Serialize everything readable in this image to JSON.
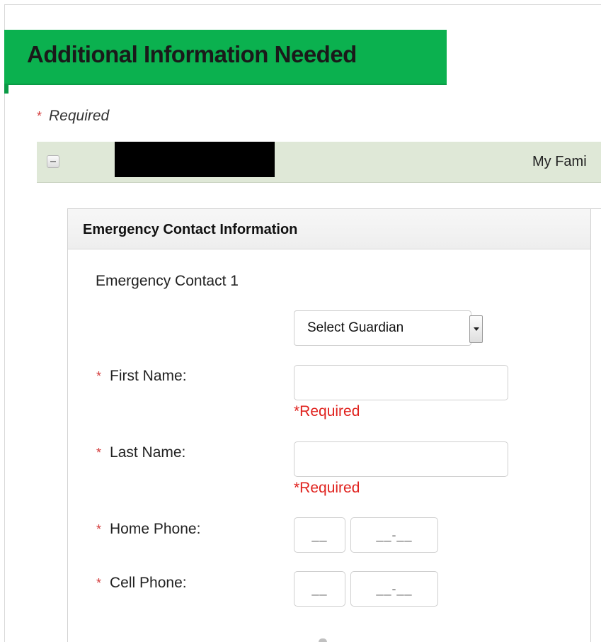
{
  "header": {
    "title": "Additional Information Needed"
  },
  "required_note": {
    "star": "*",
    "text": "Required"
  },
  "family_bar": {
    "label": "My Fami"
  },
  "panel": {
    "title": "Emergency Contact Information",
    "contact_heading": "Emergency Contact 1",
    "guardian_select": {
      "selected": "Select Guardian"
    },
    "fields": {
      "first_name": {
        "star": "*",
        "label": "First Name:",
        "value": "",
        "error": "*Required"
      },
      "last_name": {
        "star": "*",
        "label": "Last Name:",
        "value": "",
        "error": "*Required"
      },
      "home_phone": {
        "star": "*",
        "label": "Home Phone:",
        "area_placeholder": "__",
        "number_placeholder": "__-__"
      },
      "cell_phone": {
        "star": "*",
        "label": "Cell Phone:",
        "area_placeholder": "__",
        "number_placeholder": "__-__"
      }
    }
  },
  "colors": {
    "banner_green": "#0bb14f",
    "family_bar_bg": "#dfe8d7",
    "error_red": "#e0221e",
    "required_star": "#d43b3b"
  },
  "icons": {
    "collapse": "minus-square-icon",
    "select_arrow": "chevron-down-icon"
  }
}
